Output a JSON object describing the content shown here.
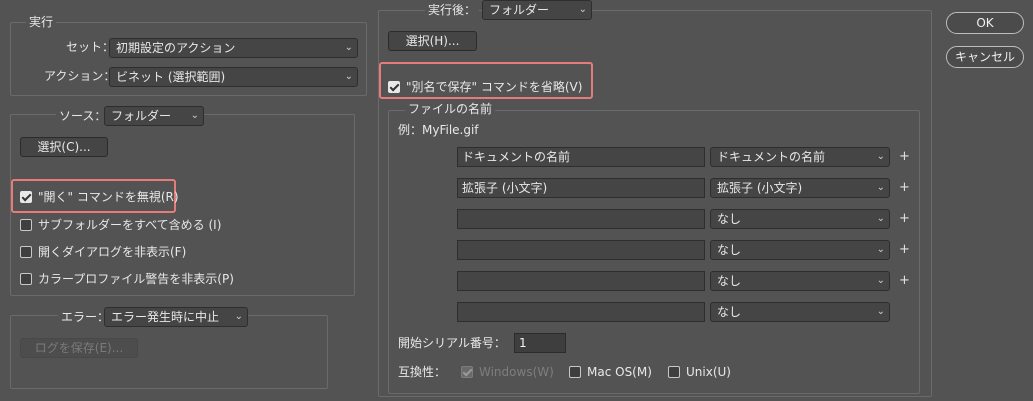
{
  "execute": {
    "legend": "実行",
    "set_label": "セット：",
    "set_value": "初期設定のアクション",
    "action_label": "アクション：",
    "action_value": "ビネット (選択範囲)"
  },
  "source": {
    "label": "ソース：",
    "value": "フォルダー",
    "select_button": "選択(C)...",
    "options": [
      {
        "label": "\"開く\" コマンドを無視(R)",
        "checked": true,
        "highlighted": true
      },
      {
        "label": "サブフォルダーをすべて含める (I)",
        "checked": false
      },
      {
        "label": "開くダイアログを非表示(F)",
        "checked": false
      },
      {
        "label": "カラープロファイル警告を非表示(P)",
        "checked": false
      }
    ]
  },
  "error": {
    "label": "エラー：",
    "value": "エラー発生時に中止",
    "save_log_button": "ログを保存(E)..."
  },
  "destination": {
    "label": "実行後：",
    "value": "フォルダー",
    "select_button": "選択(H)...",
    "override_save_as": {
      "label": "\"別名で保存\" コマンドを省略(V)",
      "checked": true,
      "highlighted": true
    },
    "file_naming": {
      "legend": "ファイルの名前",
      "example": "例：MyFile.gif",
      "rows": [
        {
          "text": "ドキュメントの名前",
          "select": "ドキュメントの名前",
          "plus": "+"
        },
        {
          "text": "拡張子 (小文字)",
          "select": "拡張子 (小文字)",
          "plus": "+"
        },
        {
          "text": "",
          "select": "なし",
          "plus": "+"
        },
        {
          "text": "",
          "select": "なし",
          "plus": "+"
        },
        {
          "text": "",
          "select": "なし",
          "plus": "+"
        },
        {
          "text": "",
          "select": "なし",
          "plus": ""
        }
      ],
      "serial_label": "開始シリアル番号：",
      "serial_value": "1",
      "compat_label": "互換性：",
      "compat": [
        {
          "label": "Windows(W)",
          "checked": true,
          "disabled": true
        },
        {
          "label": "Mac OS(M)",
          "checked": false,
          "disabled": false
        },
        {
          "label": "Unix(U)",
          "checked": false,
          "disabled": false
        }
      ]
    }
  },
  "buttons": {
    "ok": "OK",
    "cancel": "キャンセル"
  },
  "colors": {
    "background": "#535353",
    "highlight": "#e47c7c",
    "text": "#e8e8e8"
  }
}
